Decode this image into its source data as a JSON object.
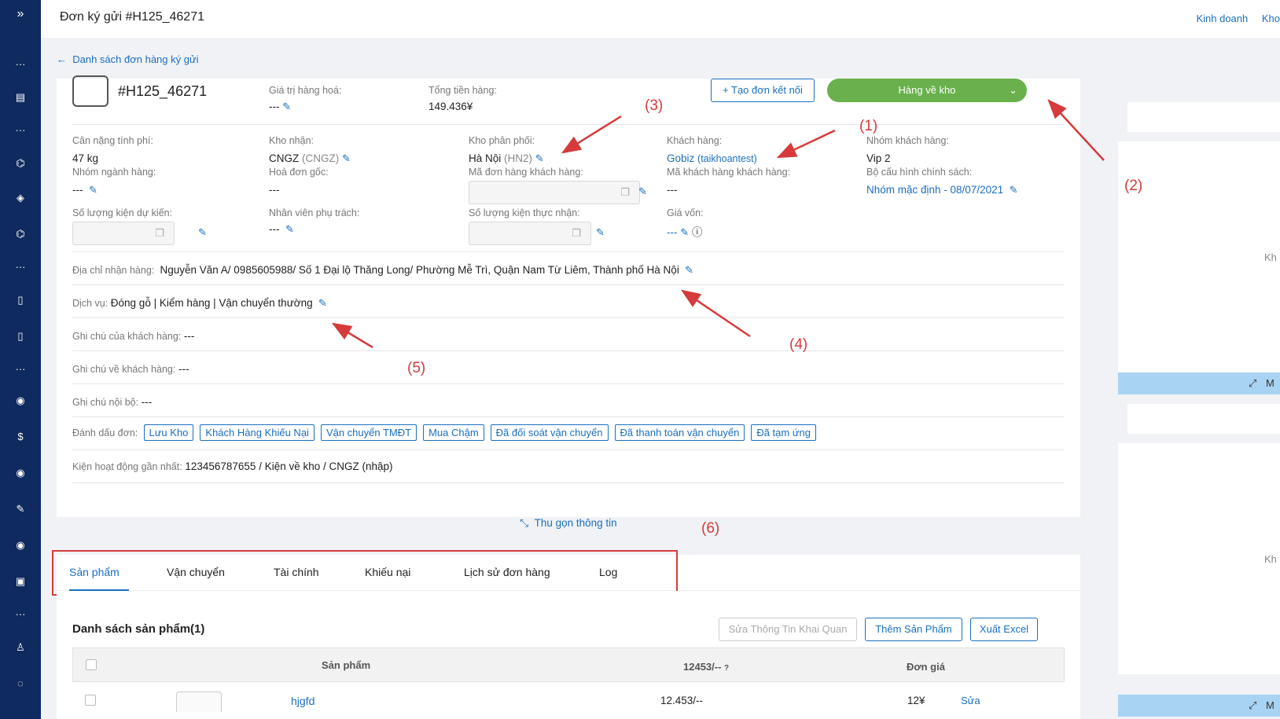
{
  "header": {
    "title": "Đơn ký gửi #H125_46271",
    "links": [
      "Kinh doanh",
      "Kho"
    ]
  },
  "back_link": "Danh sách đơn hàng ký gửi",
  "order": {
    "code": "#H125_46271",
    "goods_value_label": "Giá trị hàng hoá:",
    "goods_value": "---",
    "total_label": "Tổng tiền hàng:",
    "total": "149.436¥",
    "create_link_button": "Tạo đơn kết nối",
    "status_button": "Hàng về kho"
  },
  "fields": {
    "weight_label": "Cân nặng tính phí:",
    "weight": "47 kg",
    "warehouse_label": "Kho nhận:",
    "warehouse": "CNGZ",
    "warehouse_code": "(CNGZ)",
    "dist_label": "Kho phân phối:",
    "dist": "Hà Nội",
    "dist_code": "(HN2)",
    "customer_label": "Khách hàng:",
    "customer": "Gobiz",
    "customer_account": "(taikhoantest)",
    "group_label": "Nhóm khách hàng:",
    "group": "Vip 2",
    "industry_label": "Nhóm ngành hàng:",
    "industry": "---",
    "invoice_label": "Hoá đơn gốc:",
    "invoice": "---",
    "cust_order_label": "Mã đơn hàng khách hàng:",
    "cust_code_label": "Mã khách hàng khách hàng:",
    "cust_code": "---",
    "policy_label": "Bộ cấu hình chính sách:",
    "policy": "Nhóm mặc định - 08/07/2021",
    "expected_pkg_label": "Số lượng kiện dự kiến:",
    "staff_label": "Nhân viên phụ trách:",
    "staff": "---",
    "actual_pkg_label": "Số lượng kiện thực nhận:",
    "cost_label": "Giá vốn:",
    "cost": "---"
  },
  "rows": {
    "address_label": "Địa chỉ nhận hàng:",
    "address": "Nguyễn Văn A/ 0985605988/ Số 1 Đại lộ Thăng Long/ Phường Mễ Trì, Quận Nam Từ Liêm, Thành phố Hà Nội",
    "service_label": "Dịch vụ:",
    "service": "Đóng gỗ | Kiểm hàng | Vận chuyển thường",
    "note_customer_label": "Ghi chú của khách hàng:",
    "note_customer": "---",
    "note_about_label": "Ghi chú về khách hàng:",
    "note_about": "---",
    "note_internal_label": "Ghi chú nội bộ:",
    "note_internal": "---",
    "marks_label": "Đánh dấu đơn:",
    "marks": [
      "Lưu Kho",
      "Khách Hàng Khiếu Nại",
      "Vận chuyển TMĐT",
      "Mua Chậm",
      "Đã đối soát vận chuyển",
      "Đã thanh toán vận chuyển",
      "Đã tạm ứng"
    ],
    "last_pkg_label": "Kiện hoạt động gần nhất:",
    "last_pkg": "123456787655 / Kiện về kho / CNGZ (nhập)"
  },
  "collapse": "Thu gọn thông tin",
  "tabs": [
    "Sản phẩm",
    "Vận chuyển",
    "Tài chính",
    "Khiếu nại",
    "Lịch sử đơn hàng",
    "Log"
  ],
  "products": {
    "title": "Danh sách sản phẩm(1)",
    "btn_customs": "Sửa Thông Tin Khai Quan",
    "btn_add": "Thêm Sản Phẩm",
    "btn_excel": "Xuất Excel",
    "col_product": "Sản phẩm",
    "col_qty": "12453/--",
    "col_price": "Đơn giá",
    "row_name": "hjgfd",
    "row_qty": "12.453/--",
    "row_price": "12¥",
    "row_edit": "Sửa"
  },
  "right_panel": {
    "text1": "Kh",
    "bar1": "M",
    "text2": "Kh",
    "bar2": "M"
  },
  "annotations": [
    "(1)",
    "(2)",
    "(3)",
    "(4)",
    "(5)",
    "(6)"
  ],
  "colors": {
    "sidebar": "#0f2a5e",
    "accent": "#1b6fc2",
    "status_green": "#6ab04c",
    "annotation_red": "#d53b3b"
  }
}
